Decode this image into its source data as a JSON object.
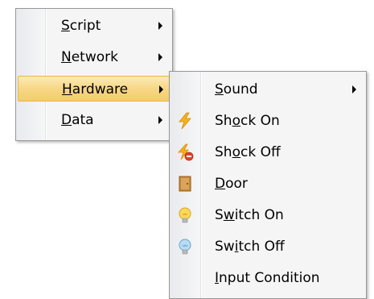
{
  "menu_main": {
    "items": [
      {
        "underline": "S",
        "rest": "cript",
        "has_submenu": true
      },
      {
        "underline": "N",
        "rest": "etwork",
        "has_submenu": true
      },
      {
        "underline": "H",
        "rest": "ardware",
        "has_submenu": true,
        "selected": true
      },
      {
        "underline": "D",
        "rest": "ata",
        "has_submenu": true
      }
    ]
  },
  "menu_hardware": {
    "items": [
      {
        "pre": "",
        "underline": "S",
        "rest": "ound",
        "icon": "none",
        "has_submenu": true
      },
      {
        "pre": "Sh",
        "underline": "o",
        "rest": "ck On",
        "icon": "lightning-icon",
        "has_submenu": false
      },
      {
        "pre": "Sh",
        "underline": "o",
        "rest": "ck Off",
        "icon": "lightning-off-icon",
        "has_submenu": false
      },
      {
        "pre": "",
        "underline": "D",
        "rest": "oor",
        "icon": "door-icon",
        "has_submenu": false
      },
      {
        "pre": "S",
        "underline": "w",
        "rest": "itch On",
        "icon": "bulb-on-icon",
        "has_submenu": false
      },
      {
        "pre": "Sw",
        "underline": "i",
        "rest": "tch Off",
        "icon": "bulb-off-icon",
        "has_submenu": false
      },
      {
        "pre": "",
        "underline": "I",
        "rest": "nput Condition",
        "icon": "none",
        "has_submenu": false
      }
    ]
  },
  "colors": {
    "highlight_top": "#fbeab8",
    "highlight_bottom": "#f4cc6a",
    "highlight_border": "#e7b84e",
    "menu_bg": "#f5f5f5",
    "menu_border": "#979797"
  }
}
